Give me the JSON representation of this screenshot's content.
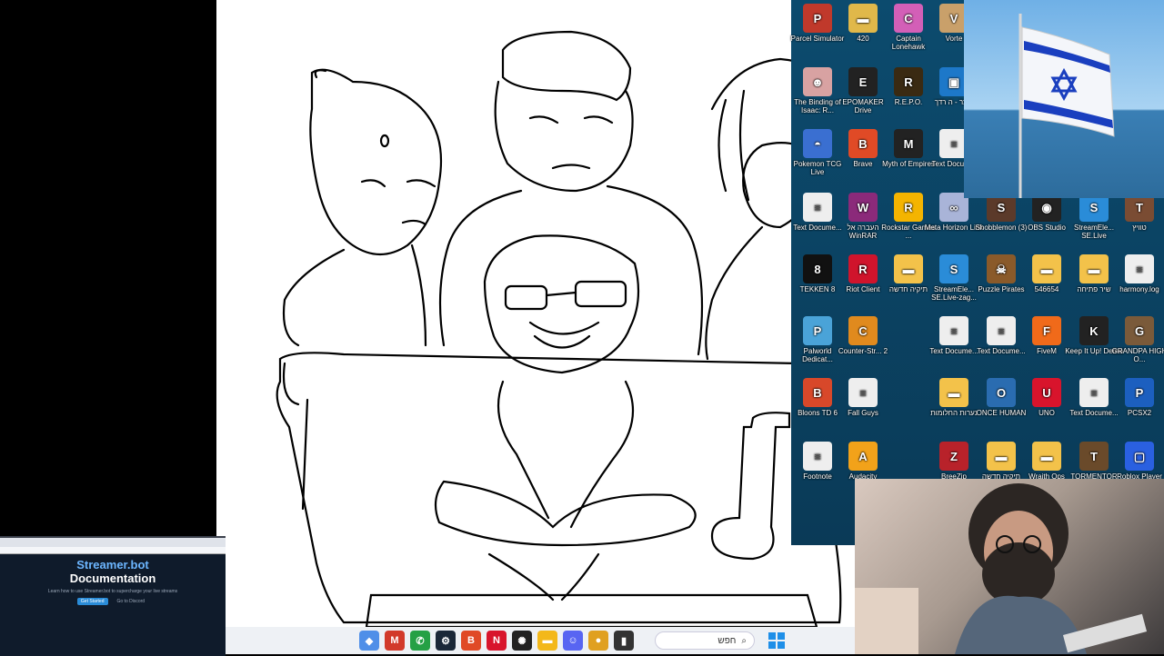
{
  "desktop_icons": [
    {
      "label": "Parcel Simulator",
      "x": 0,
      "color": "#c0392b",
      "g": "P"
    },
    {
      "label": "420",
      "x": 1,
      "color": "#e0b84a",
      "g": "▬"
    },
    {
      "label": "Captain Lonehawk",
      "x": 2,
      "color": "#d35fb7",
      "g": "C"
    },
    {
      "label": "Vorte",
      "x": 3,
      "color": "#c9a06a",
      "g": "V"
    },
    {
      "label": "The Binding of Isaac: R...",
      "x": 0,
      "row": 1,
      "color": "#d8a2a2",
      "g": "☻"
    },
    {
      "label": "EPOMAKER Drive",
      "x": 1,
      "row": 1,
      "color": "#222",
      "g": "E"
    },
    {
      "label": "R.E.P.O.",
      "x": 2,
      "row": 1,
      "color": "#3a2a12",
      "g": "R"
    },
    {
      "label": "קוצר - ה רדך",
      "x": 3,
      "row": 1,
      "color": "#1d78c9",
      "g": "▣"
    },
    {
      "label": "Pokemon TCG Live",
      "x": 0,
      "row": 2,
      "color": "#3a6fd1",
      "g": "◓"
    },
    {
      "label": "Brave",
      "x": 1,
      "row": 2,
      "color": "#e04a26",
      "g": "B"
    },
    {
      "label": "Myth of Empires",
      "x": 2,
      "row": 2,
      "color": "#222",
      "g": "M"
    },
    {
      "label": "Text Docum...",
      "x": 3,
      "row": 2,
      "color": "#eee",
      "g": "≡"
    },
    {
      "label": "Text Docume...",
      "x": 0,
      "row": 3,
      "color": "#eee",
      "g": "≡"
    },
    {
      "label": "העברה אל WinRAR",
      "x": 1,
      "row": 3,
      "color": "#8b2a7a",
      "g": "W"
    },
    {
      "label": "Rockstar Games ...",
      "x": 2,
      "row": 3,
      "color": "#f4b400",
      "g": "R"
    },
    {
      "label": "Meta Horizon Link",
      "x": 3,
      "row": 3,
      "color": "#a9b4d8",
      "g": "∞"
    },
    {
      "label": "Shobblemon (3)",
      "x": 4,
      "row": 3,
      "color": "#5b3a2a",
      "g": "S"
    },
    {
      "label": "OBS Studio",
      "x": 5,
      "row": 3,
      "color": "#222",
      "g": "◉"
    },
    {
      "label": "StreamEle... SE.Live",
      "x": 6,
      "row": 3,
      "color": "#2a8cd8",
      "g": "S"
    },
    {
      "label": "טוויץ",
      "x": 7,
      "row": 3,
      "color": "#7a4c33",
      "g": "T"
    },
    {
      "label": "TEKKEN 8",
      "x": 0,
      "row": 4,
      "color": "#111",
      "g": "8"
    },
    {
      "label": "Riot Client",
      "x": 1,
      "row": 4,
      "color": "#d0142c",
      "g": "R"
    },
    {
      "label": "תיקיה חדשה",
      "x": 2,
      "row": 4,
      "color": "#f3c24a",
      "g": "▬"
    },
    {
      "label": "StreamEle... SE.Live-zag...",
      "x": 3,
      "row": 4,
      "color": "#2a8cd8",
      "g": "S"
    },
    {
      "label": "Puzzle Pirates",
      "x": 4,
      "row": 4,
      "color": "#8a5a2a",
      "g": "☠"
    },
    {
      "label": "546654",
      "x": 5,
      "row": 4,
      "color": "#f3c24a",
      "g": "▬"
    },
    {
      "label": "שיר פתיחה",
      "x": 6,
      "row": 4,
      "color": "#f3c24a",
      "g": "▬"
    },
    {
      "label": "harmony.log",
      "x": 7,
      "row": 4,
      "color": "#eee",
      "g": "≡"
    },
    {
      "label": "Palworld Dedicat...",
      "x": 0,
      "row": 5,
      "color": "#4aa3d8",
      "g": "P"
    },
    {
      "label": "Counter-Str... 2",
      "x": 1,
      "row": 5,
      "color": "#e08a1e",
      "g": "C"
    },
    {
      "label": "Text Docume...",
      "x": 3,
      "row": 5,
      "color": "#eee",
      "g": "≡"
    },
    {
      "label": "Text Docume...",
      "x": 4,
      "row": 5,
      "color": "#eee",
      "g": "≡"
    },
    {
      "label": "FiveM",
      "x": 5,
      "row": 5,
      "color": "#f06a1a",
      "g": "F"
    },
    {
      "label": "Keep It Up! Demo",
      "x": 6,
      "row": 5,
      "color": "#222",
      "g": "K"
    },
    {
      "label": "GRANDPA HIGH O...",
      "x": 7,
      "row": 5,
      "color": "#7a5a3a",
      "g": "G"
    },
    {
      "label": "Bloons TD 6",
      "x": 0,
      "row": 6,
      "color": "#d8482a",
      "g": "B"
    },
    {
      "label": "Fall Guys",
      "x": 1,
      "row": 6,
      "color": "#eee",
      "g": "≡"
    },
    {
      "label": "נערות החלומות",
      "x": 3,
      "row": 6,
      "color": "#f3c24a",
      "g": "▬"
    },
    {
      "label": "ONCE HUMAN",
      "x": 4,
      "row": 6,
      "color": "#2a6cb0",
      "g": "O"
    },
    {
      "label": "UNO",
      "x": 5,
      "row": 6,
      "color": "#d8142c",
      "g": "U"
    },
    {
      "label": "Text Docume...",
      "x": 6,
      "row": 6,
      "color": "#eee",
      "g": "≡"
    },
    {
      "label": "PCSX2",
      "x": 7,
      "row": 6,
      "color": "#1c5fbf",
      "g": "P"
    },
    {
      "label": "Footnote",
      "x": 0,
      "row": 7,
      "color": "#eee",
      "g": "≡"
    },
    {
      "label": "Audacity",
      "x": 1,
      "row": 7,
      "color": "#f2a21a",
      "g": "A"
    },
    {
      "label": "BreeZip",
      "x": 3,
      "row": 7,
      "color": "#b8222a",
      "g": "Z"
    },
    {
      "label": "תיקיה חדשה",
      "x": 4,
      "row": 7,
      "color": "#f3c24a",
      "g": "▬"
    },
    {
      "label": "Wraith Ops",
      "x": 5,
      "row": 7,
      "color": "#f3c24a",
      "g": "▬"
    },
    {
      "label": "TORMENTOR",
      "x": 6,
      "row": 7,
      "color": "#6a4a2a",
      "g": "T"
    },
    {
      "label": "Roblox Player",
      "x": 7,
      "row": 7,
      "color": "#2a60e0",
      "g": "▢"
    }
  ],
  "browser": {
    "brand": "Streamer.bot",
    "title": "Documentation",
    "tagline": "Learn how to use Streamer.bot to supercharge your live streams",
    "button1": "Get Started",
    "button2": "Go to Discord"
  },
  "taskbar": {
    "search_text": "חפש",
    "apps": [
      {
        "name": "dev-home-icon",
        "g": "◆",
        "color": "#4f8fe8"
      },
      {
        "name": "mail-icon",
        "g": "M",
        "color": "#d23a2a"
      },
      {
        "name": "whatsapp-icon",
        "g": "✆",
        "color": "#25a045"
      },
      {
        "name": "steam-icon",
        "g": "⚙",
        "color": "#1b2838"
      },
      {
        "name": "brave-icon",
        "g": "B",
        "color": "#e04a26"
      },
      {
        "name": "netflix-icon",
        "g": "N",
        "color": "#d8142c"
      },
      {
        "name": "chatgpt-icon",
        "g": "✺",
        "color": "#222"
      },
      {
        "name": "file-explorer-icon",
        "g": "▬",
        "color": "#f3b81a"
      },
      {
        "name": "discord-icon",
        "g": "☺",
        "color": "#5865f2"
      },
      {
        "name": "app-icon",
        "g": "●",
        "color": "#e0a020"
      },
      {
        "name": "terminal-icon",
        "g": "▮",
        "color": "#333"
      }
    ]
  }
}
